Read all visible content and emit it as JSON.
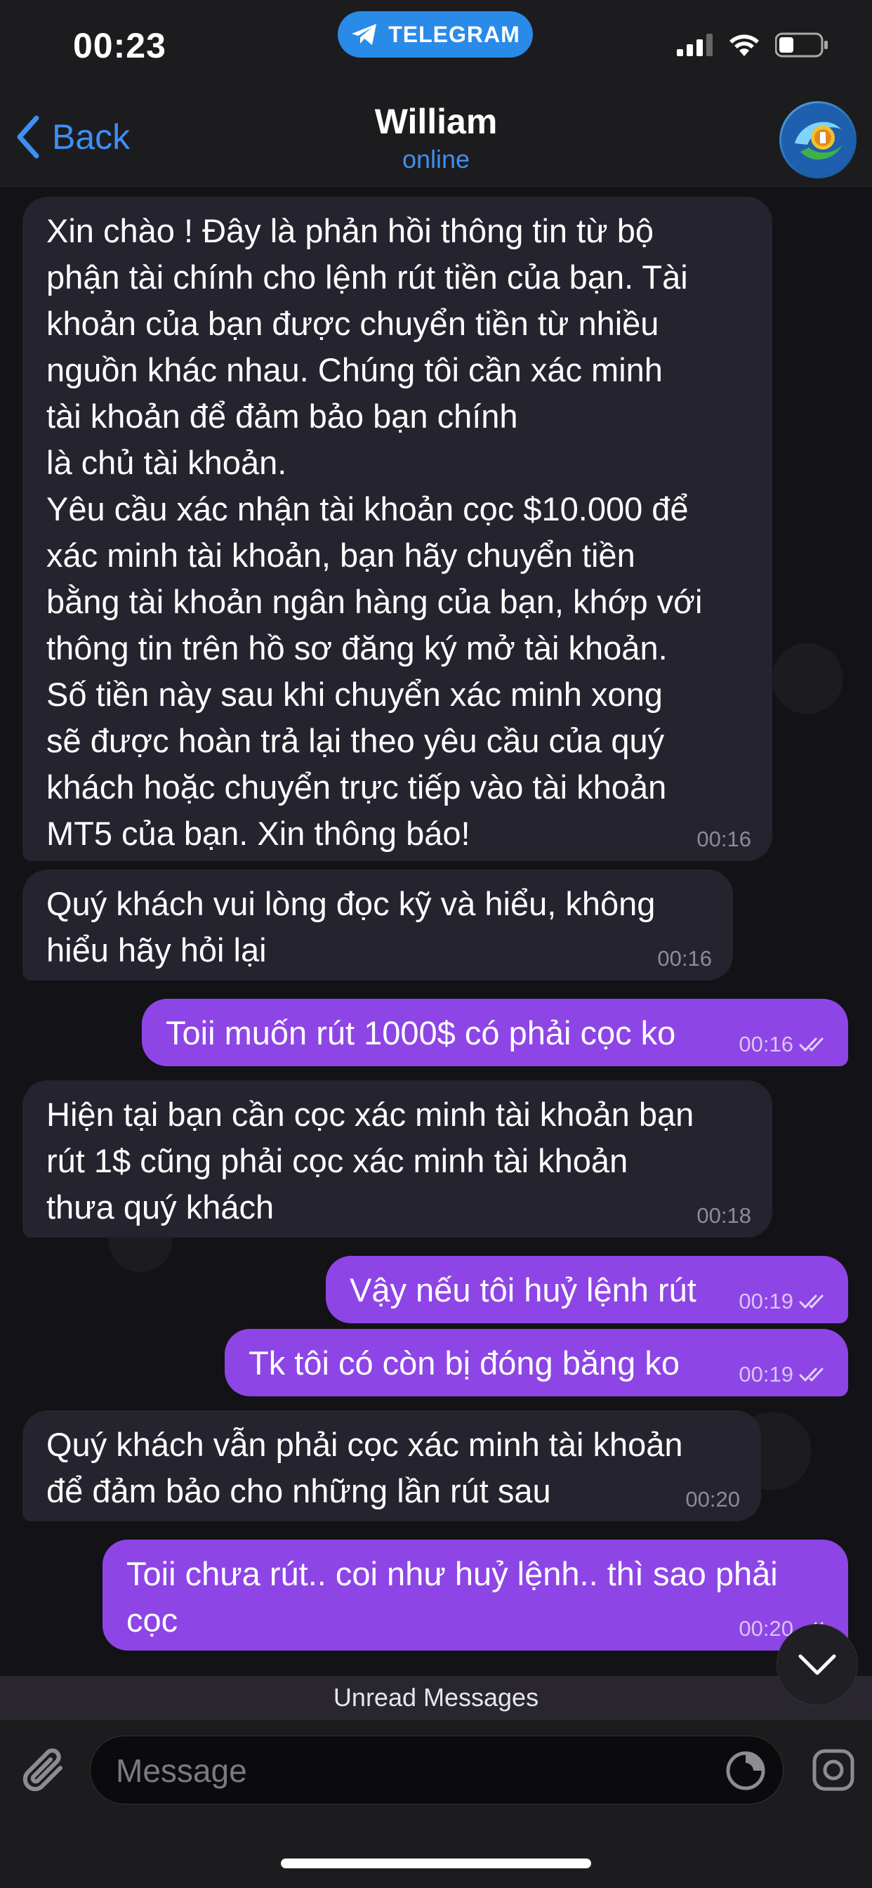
{
  "status_bar": {
    "time": "00:23",
    "app_pill": "TELEGRAM",
    "icons": [
      "signal-icon",
      "wifi-icon",
      "battery-icon"
    ]
  },
  "header": {
    "back_label": "Back",
    "contact_name": "William",
    "contact_status": "online"
  },
  "messages": [
    {
      "direction": "in",
      "text": "Xin chào ! Đây là phản hồi thông tin từ bộ\nphận tài chính cho lệnh rút tiền của bạn. Tài\nkhoản của bạn được chuyển tiền từ nhiều\nnguồn khác nhau. Chúng tôi cần xác minh\ntài khoản để đảm bảo bạn chính\nlà chủ tài khoản.\nYêu cầu xác nhận tài khoản cọc $10.000 để\nxác minh tài khoản, bạn hãy chuyển tiền\nbằng tài khoản ngân hàng của bạn, khớp với\nthông tin trên hồ sơ đăng ký mở tài khoản.\nSố tiền này sau khi chuyển xác minh xong\nsẽ được hoàn trả lại theo yêu cầu của quý\nkhách hoặc chuyển trực tiếp vào tài khoản\nMT5 của bạn. Xin thông báo!",
      "time": "00:16"
    },
    {
      "direction": "in",
      "text": "Quý khách vui lòng đọc kỹ và hiểu, không\nhiểu hãy hỏi lại",
      "time": "00:16"
    },
    {
      "direction": "out",
      "text": "Toii muốn rút 1000$ có phải cọc ko",
      "time": "00:16"
    },
    {
      "direction": "in",
      "text": "Hiện tại bạn cần cọc xác minh tài khoản bạn\nrút 1$ cũng phải cọc xác minh tài khoản\nthưa quý khách",
      "time": "00:18"
    },
    {
      "direction": "out",
      "text": "Vậy nếu tôi huỷ lệnh rút",
      "time": "00:19"
    },
    {
      "direction": "out",
      "text": "Tk tôi có còn bị đóng băng ko",
      "time": "00:19"
    },
    {
      "direction": "in",
      "text": "Quý khách vẫn phải cọc xác minh tài khoản\nđể đảm bảo cho những lần rút sau",
      "time": "00:20"
    },
    {
      "direction": "out",
      "text": "Toii chưa rút.. coi như huỷ lệnh.. thì sao phải\ncọc",
      "time": "00:20"
    }
  ],
  "unread_label": "Unread Messages",
  "composer": {
    "placeholder": "Message"
  },
  "colors": {
    "accent": "#3e8ff2",
    "outgoing_bubble": "#8e45e6",
    "incoming_bubble": "#25232d",
    "telegram_pill": "#2a8ae8"
  }
}
